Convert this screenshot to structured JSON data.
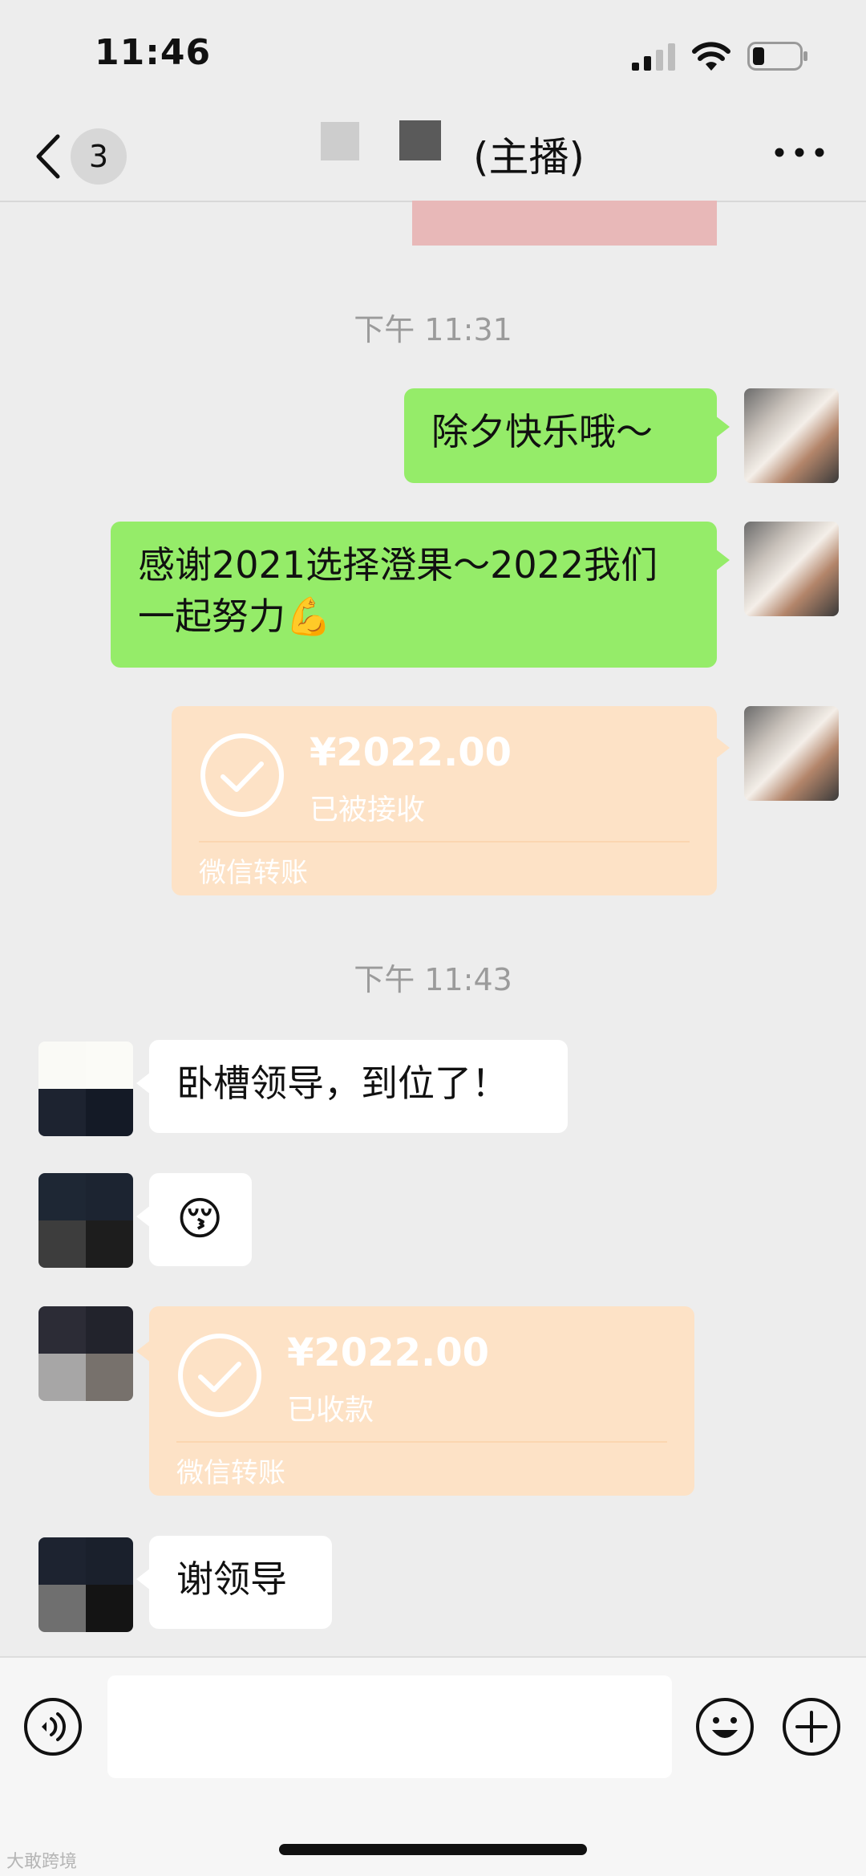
{
  "status_bar": {
    "time": "11:46"
  },
  "nav": {
    "back_badge": "3",
    "title": "(主播)",
    "more_icon": "more-dots-icon"
  },
  "timestamps": [
    "下午 11:31",
    "下午 11:43"
  ],
  "messages": [
    {
      "from": "me",
      "type": "text",
      "text": "除夕快乐哦～"
    },
    {
      "from": "me",
      "type": "text",
      "text": "感谢2021选择澄果～2022我们一起努力💪"
    },
    {
      "from": "me",
      "type": "transfer",
      "amount": "¥2022.00",
      "status": "已被接收",
      "label": "微信转账"
    },
    {
      "from": "other",
      "type": "text",
      "text": "卧槽领导，到位了！"
    },
    {
      "from": "other",
      "type": "emoji",
      "text": "😚"
    },
    {
      "from": "other",
      "type": "transfer",
      "amount": "¥2022.00",
      "status": "已收款",
      "label": "微信转账"
    },
    {
      "from": "other",
      "type": "text",
      "text": "谢领导"
    }
  ],
  "input_bar": {
    "voice_icon": "voice-icon",
    "emoji_icon": "emoji-face-icon",
    "plus_icon": "plus-icon"
  },
  "watermark": "大敢跨境",
  "colors": {
    "sent_bubble": "#95ec69",
    "received_bubble": "#ffffff",
    "transfer_card": "#fde2c6",
    "background": "#ededed"
  }
}
